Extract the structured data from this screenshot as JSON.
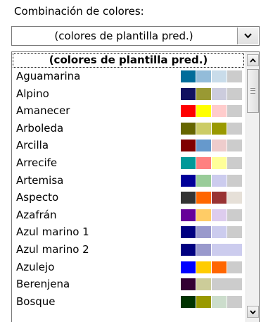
{
  "label": "Combinación de colores:",
  "combo": {
    "value": "(colores de plantilla pred.)"
  },
  "list": {
    "header": "(colores de plantilla pred.)",
    "items": [
      {
        "label": "Aguamarina",
        "colors": [
          "#006c9a",
          "#93bcd9",
          "#c9dcea",
          "#cccccc"
        ]
      },
      {
        "label": "Alpino",
        "colors": [
          "#101060",
          "#999933",
          "#ccccdd",
          "#cccccc"
        ]
      },
      {
        "label": "Amanecer",
        "colors": [
          "#ff0000",
          "#ffff00",
          "#ffcccc",
          "#cccccc"
        ]
      },
      {
        "label": "Arboleda",
        "colors": [
          "#666600",
          "#cccc66",
          "#999900",
          "#cccccc"
        ]
      },
      {
        "label": "Arcilla",
        "colors": [
          "#800000",
          "#6699cc",
          "#eecccc",
          "#cccccc"
        ]
      },
      {
        "label": "Arrecife",
        "colors": [
          "#009999",
          "#ff8080",
          "#ffff99",
          "#cccccc"
        ]
      },
      {
        "label": "Artemisa",
        "colors": [
          "#000099",
          "#99cc99",
          "#ccccee",
          "#cccccc"
        ]
      },
      {
        "label": "Aspecto",
        "colors": [
          "#333333",
          "#ff6600",
          "#993333",
          "#e6e0d8"
        ]
      },
      {
        "label": "Azafrán",
        "colors": [
          "#660099",
          "#ffcc66",
          "#ddccee",
          "#cccccc"
        ]
      },
      {
        "label": "Azul marino 1",
        "colors": [
          "#000080",
          "#9999cc",
          "#ccccee",
          "#cccccc"
        ]
      },
      {
        "label": "Azul marino 2",
        "colors": [
          "#000080",
          "#9999cc",
          "#ccccee"
        ]
      },
      {
        "label": "Azulejo",
        "colors": [
          "#0000ff",
          "#ffcc00",
          "#ff6600",
          "#cccccc"
        ]
      },
      {
        "label": "Berenjena",
        "colors": [
          "#330033",
          "#cccc99",
          "#cccccc"
        ]
      },
      {
        "label": "Bosque",
        "colors": [
          "#003300",
          "#999900",
          "#ccddcc",
          "#cccccc"
        ]
      }
    ]
  }
}
